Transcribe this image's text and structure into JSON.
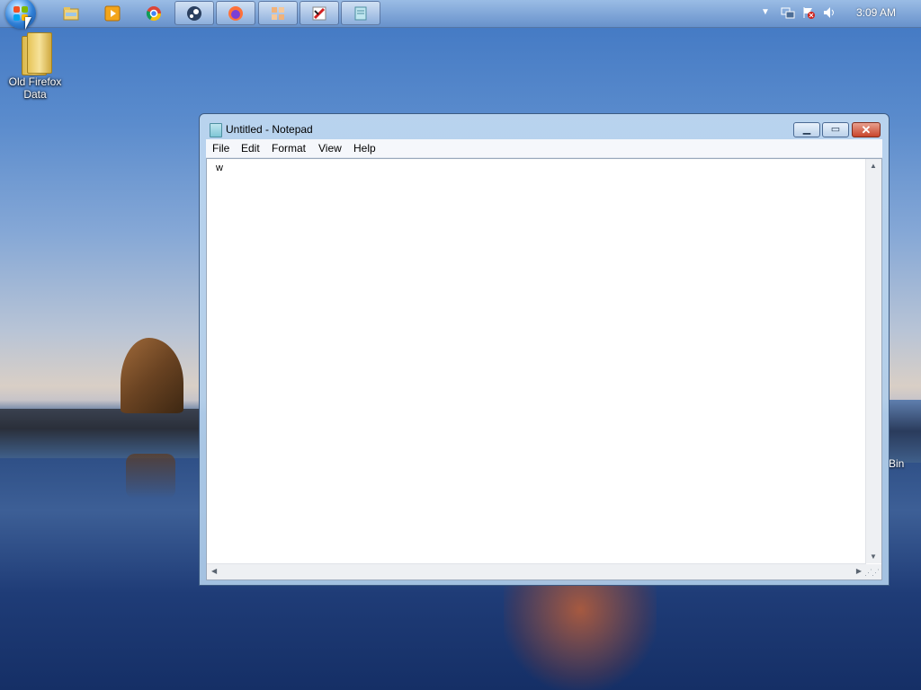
{
  "taskbar": {
    "pinned": [
      {
        "name": "file-explorer-icon"
      },
      {
        "name": "media-player-icon"
      },
      {
        "name": "chrome-icon"
      }
    ],
    "running": [
      {
        "name": "steam-icon"
      },
      {
        "name": "firefox-icon"
      },
      {
        "name": "app-grid-icon"
      },
      {
        "name": "pdf-app-icon"
      },
      {
        "name": "notepad-taskbar-icon"
      }
    ],
    "tray": {
      "clock": "3:09 AM"
    }
  },
  "desktop": {
    "icons": [
      {
        "label": "Old Firefox Data"
      }
    ],
    "partial_label": "Bin"
  },
  "notepad": {
    "title": "Untitled - Notepad",
    "menu": [
      "File",
      "Edit",
      "Format",
      "View",
      "Help"
    ],
    "content": "w"
  },
  "colors": {
    "titlebar": "#bcd6ef",
    "close_button": "#c9452b"
  }
}
